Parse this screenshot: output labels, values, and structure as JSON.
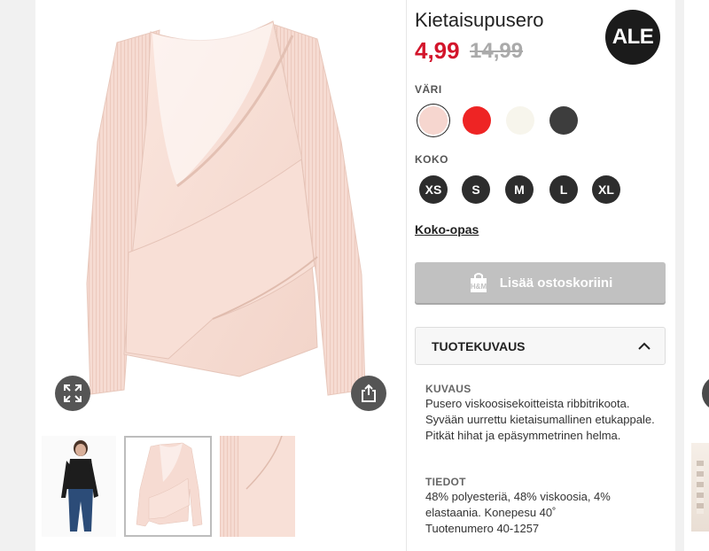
{
  "product": {
    "title": "Kietaisupusero",
    "sale_price": "4,99",
    "original_price": "14,99",
    "badge": "ALE"
  },
  "colors": {
    "label": "VÄRI",
    "swatches": [
      {
        "name": "light-pink",
        "hex": "#f6d6cf",
        "selected": true
      },
      {
        "name": "red",
        "hex": "#ee2424",
        "selected": false
      },
      {
        "name": "off-white",
        "hex": "#f7f5ec",
        "selected": false
      },
      {
        "name": "dark-grey",
        "hex": "#3d3d3d",
        "selected": false
      }
    ]
  },
  "sizes": {
    "label": "KOKO",
    "options": [
      "XS",
      "S",
      "M",
      "L",
      "XL"
    ]
  },
  "size_guide": "Koko-opas",
  "add_to_cart": "Lisää ostoskoriini",
  "bag_logo": "H&M",
  "accordion": {
    "title": "TUOTEKUVAUS",
    "description_label": "KUVAUS",
    "description_text": "Pusero viskoosisekoitteista ribbitrikoota. Syvään uurrettu kietaisumallinen etukappale. Pitkät hihat ja epäsymmetrinen helma.",
    "details_label": "TIEDOT",
    "details_text": "48% polyesteriä, 48% viskoosia, 4% elastaania. Konepesu 40˚",
    "product_number": "Tuotenumero 40-1257"
  },
  "icons": {
    "expand": "expand-icon",
    "share": "share-icon",
    "chevron": "chevron-up-icon",
    "bag": "shopping-bag-icon"
  },
  "colors_theme": {
    "sale_red": "#d3152b",
    "badge_black": "#1b1b1b",
    "button_disabled": "#c1c1c1",
    "garment_pink": "#f6dbd2"
  }
}
